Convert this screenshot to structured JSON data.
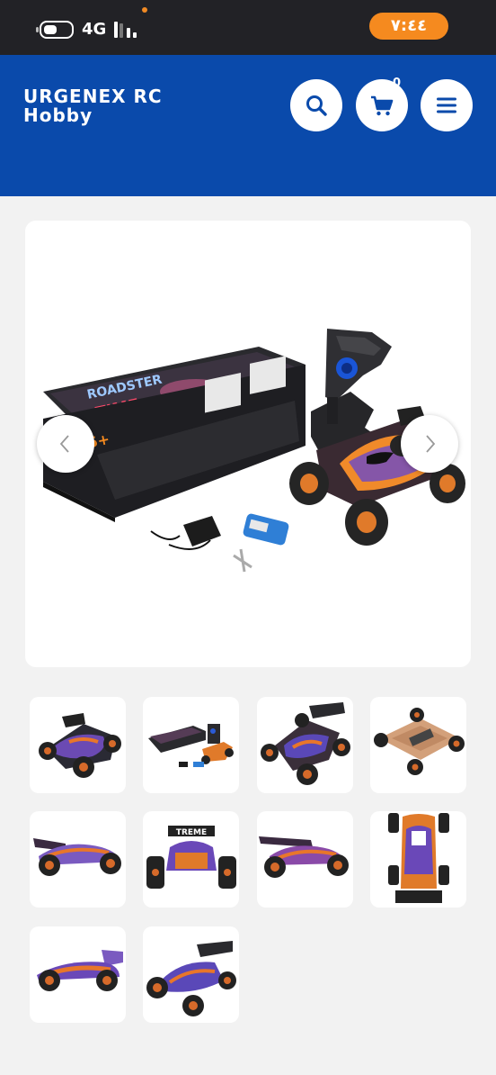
{
  "status_bar": {
    "network": "4G",
    "time": "٧:٤٤"
  },
  "header": {
    "brand_line1": "URGENEX RC",
    "brand_line2": "Hobby",
    "cart_count": "0"
  },
  "gallery": {
    "main_image": "rc-buggy-package-box-controller-car-battery",
    "box_text_1": "ROADSTER",
    "box_text_2": "TIME",
    "box_text_3": "TREME",
    "thumbnails": [
      "car-side-rear-view",
      "package-contents",
      "car-front-quarter",
      "car-underside-chassis",
      "car-left-side",
      "car-front-view",
      "car-right-side",
      "car-top-view",
      "car-side-profile",
      "car-rear-quarter"
    ]
  },
  "colors": {
    "header_blue": "#0a4aab",
    "accent_orange": "#f58a1f",
    "status_bar": "#222226"
  }
}
